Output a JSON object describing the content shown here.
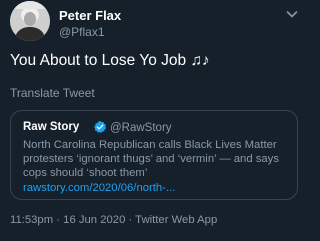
{
  "author": {
    "display_name": "Peter Flax",
    "handle": "@Pflax1",
    "avatar_icon": "profile-photo"
  },
  "tweet": {
    "text": "You About to Lose Yo Job ♫♪",
    "translate_label": "Translate Tweet",
    "timestamp": "11:53pm · 16 Jun 2020 · Twitter Web App"
  },
  "quoted_tweet": {
    "display_name": "Raw Story",
    "verified": true,
    "handle": "@RawStory",
    "text": "North Carolina Republican calls Black Lives Matter protesters ‘ignorant thugs’ and ‘vermin’ — and says cops should ‘shoot them’",
    "link_text": "rawstory.com/2020/06/north-..."
  },
  "colors": {
    "background": "#15202b",
    "secondary_text": "#8899a6",
    "link": "#1da1f2",
    "border": "#38444d",
    "verified_badge": "#1da1f2"
  },
  "icons": {
    "more_menu": "chevron-down-icon",
    "verified": "verified-badge-icon"
  }
}
